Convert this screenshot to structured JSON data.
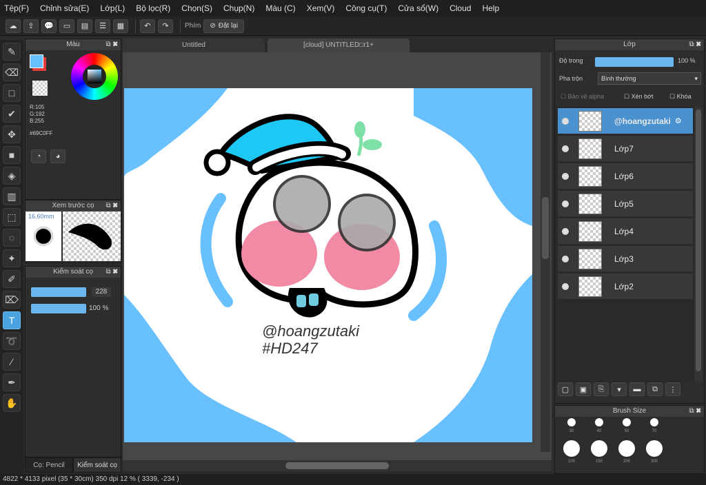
{
  "menu": [
    "Tệp(F)",
    "Chỉnh sửa(E)",
    "Lớp(L)",
    "Bộ lọc(R)",
    "Chọn(S)",
    "Chụp(N)",
    "Màu (C)",
    "Xem(V)",
    "Công cụ(T)",
    "Cửa sổ(W)",
    "Cloud",
    "Help"
  ],
  "toolbar": {
    "phim_label": "Phím",
    "reset_label": "Đặt lại"
  },
  "color_panel": {
    "title": "Màu",
    "r": "R:105",
    "g": "G:192",
    "b": "B:255",
    "hex": "#69C0FF",
    "main_color": "#69C0FF",
    "secondary_color": "#e03a3a"
  },
  "brush_preview": {
    "title": "Xem trước cọ",
    "size": "16.60mm"
  },
  "brush_control": {
    "title": "Kiểm soát cọ",
    "size_value": "228",
    "opacity_value": "100 %"
  },
  "bottom_tabs": [
    "Cọ: Pencil",
    "Kiểm soát cọ"
  ],
  "canvas_tabs": [
    "Untitled",
    "[cloud] UNTITLED□r1+"
  ],
  "artwork": {
    "handle": "@hoangzutaki",
    "tag": "#HD247",
    "bg_blue": "#69C0FF",
    "hat_blue": "#1ec8f5",
    "cheek_pink": "#f08aa5",
    "sprout_green": "#7ee0a7"
  },
  "layers": {
    "title": "Lớp",
    "opacity_label": "Độ trong",
    "opacity_value": "100 %",
    "blend_label": "Pha trộn",
    "blend_value": "Bình thường",
    "protect_alpha": "Bảo vệ alpha",
    "clip": "Xén bớt",
    "lock": "Khóa",
    "items": [
      {
        "name": "@hoangzutaki",
        "selected": true
      },
      {
        "name": "Lớp7"
      },
      {
        "name": "Lớp6"
      },
      {
        "name": "Lớp5"
      },
      {
        "name": "Lớp4"
      },
      {
        "name": "Lớp3"
      },
      {
        "name": "Lớp2"
      }
    ]
  },
  "brush_size": {
    "title": "Brush Size",
    "row1": [
      "30",
      "40",
      "50",
      "70"
    ],
    "row2": [
      "100",
      "150",
      "200",
      "300"
    ]
  },
  "status": {
    "text": "4822 * 4133 pixel  (35 * 30cm)  350 dpi  12 %  ( 3339, -234 )"
  }
}
